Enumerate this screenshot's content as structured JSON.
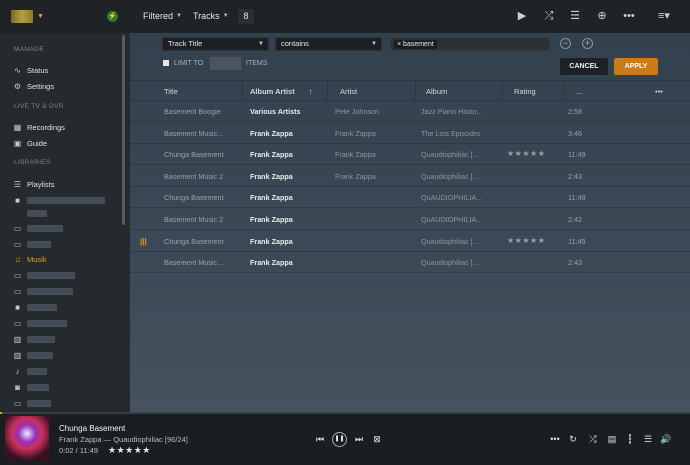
{
  "topbar": {
    "filter_label": "Filtered",
    "type_label": "Tracks",
    "count": "8"
  },
  "sidebar": {
    "manage_header": "MANAGE",
    "status": "Status",
    "settings": "Settings",
    "livetv_header": "LIVE TV & DVR",
    "recordings": "Recordings",
    "guide": "Guide",
    "libraries_header": "LIBRARIES",
    "playlists": "Playlists",
    "musik": "Musik"
  },
  "filter": {
    "field": "Track Title",
    "operator": "contains",
    "tag_value": "basement",
    "limit_label": "LIMIT TO",
    "items_label": "ITEMS",
    "cancel": "CANCEL",
    "apply": "APPLY"
  },
  "table": {
    "headers": {
      "title": "Title",
      "album_artist": "Album Artist",
      "artist": "Artist",
      "album": "Album",
      "rating": "Rating",
      "duration": "..."
    },
    "rows": [
      {
        "title": "Basement Boogie",
        "album_artist": "Various Artists",
        "artist": "Pete Johnson",
        "album": "Jazz Piano Histor...",
        "rating": 0,
        "duration": "2:58"
      },
      {
        "title": "Basement Music...",
        "album_artist": "Frank Zappa",
        "artist": "Frank Zappa",
        "album": "The Lost Episodes",
        "rating": 0,
        "duration": "3:46"
      },
      {
        "title": "Chunga Basement",
        "album_artist": "Frank Zappa",
        "artist": "Frank Zappa",
        "album": "Quaudiophiliac [...",
        "rating": 5,
        "duration": "11:49"
      },
      {
        "title": "Basement Music 2",
        "album_artist": "Frank Zappa",
        "artist": "Frank Zappa",
        "album": "Quaudiophiliac [...",
        "rating": 0,
        "duration": "2:43"
      },
      {
        "title": "Chunga Basement",
        "album_artist": "Frank Zappa",
        "artist": "",
        "album": "QuAUDIOPHILIA...",
        "rating": 0,
        "duration": "11:48"
      },
      {
        "title": "Basement Music 2",
        "album_artist": "Frank Zappa",
        "artist": "",
        "album": "QuAUDIOPHILIA...",
        "rating": 0,
        "duration": "2:42"
      },
      {
        "title": "Chunga Basement",
        "album_artist": "Frank Zappa",
        "artist": "",
        "album": "Quaudiophiliac [...",
        "rating": 5,
        "duration": "11:49"
      },
      {
        "title": "Basement Music...",
        "album_artist": "Frank Zappa",
        "artist": "",
        "album": "Quaudiophiliac [...",
        "rating": 0,
        "duration": "2:43"
      }
    ]
  },
  "player": {
    "title": "Chunga Basement",
    "subtitle": "Frank Zappa — Quaudiophiliac [96/24]",
    "time": "0:02 / 11:49",
    "stars": "★★★★★",
    "progress": 0.003
  },
  "colors": {
    "accent": "#e5a00d",
    "apply": "#cc7b19"
  }
}
